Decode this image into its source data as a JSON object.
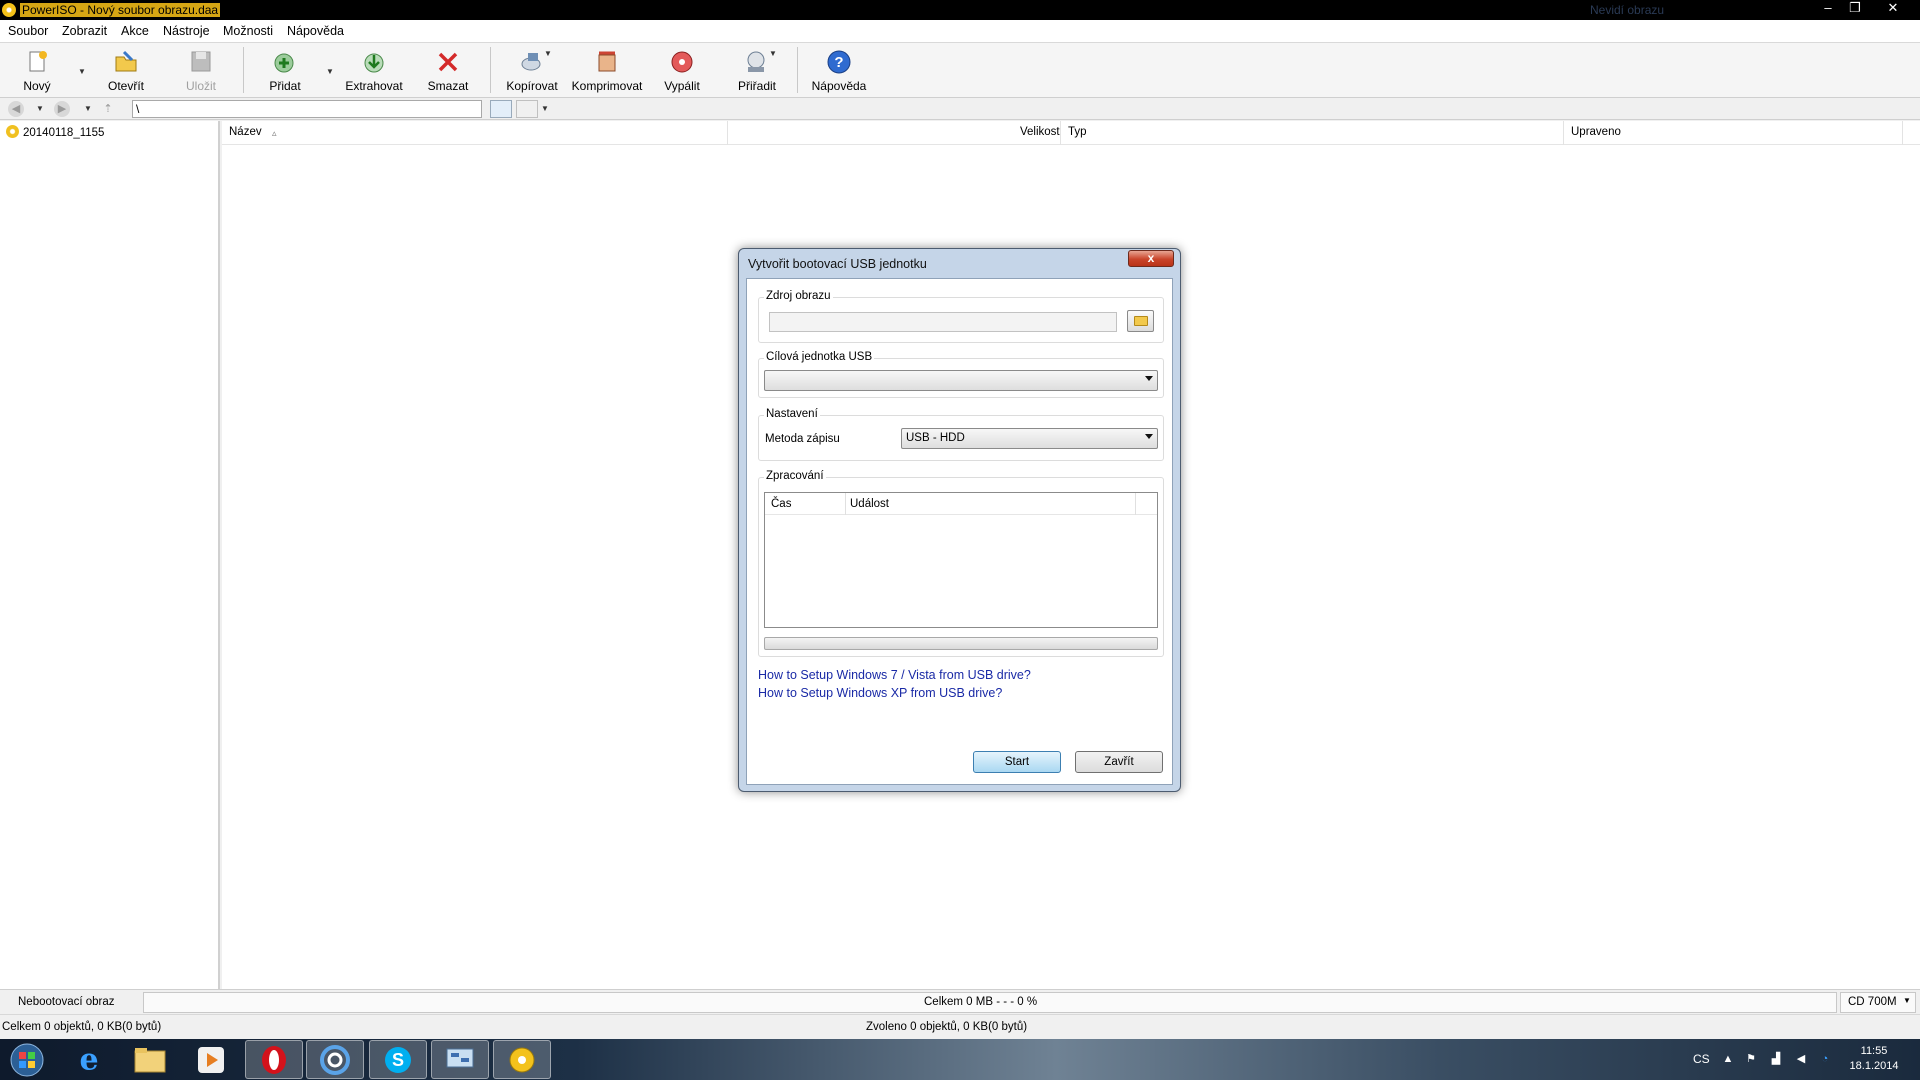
{
  "window": {
    "title": "PowerISO - Nový soubor obrazu.daa",
    "ghost_title": "Nevidí obrazu",
    "controls": [
      "–",
      "❐",
      "✕"
    ]
  },
  "menu": [
    "Soubor",
    "Zobrazit",
    "Akce",
    "Nástroje",
    "Možnosti",
    "Nápověda"
  ],
  "toolbar": {
    "new": "Nový",
    "open": "Otevřít",
    "save": "Uložit",
    "add": "Přidat",
    "extract": "Extrahovat",
    "delete": "Smazat",
    "copy": "Kopírovat",
    "compress": "Komprimovat",
    "burn": "Vypálit",
    "mount": "Přiřadit",
    "help": "Nápověda"
  },
  "address": {
    "path": "\\"
  },
  "tree": {
    "root": "20140118_1155"
  },
  "filelist": {
    "columns": {
      "name": "Název",
      "size": "Velikost",
      "type": "Typ",
      "modified": "Upraveno"
    },
    "sort_indicator": "▵"
  },
  "status": {
    "boot": "Nebootovací obraz",
    "total": "Celkem  0 MB   - - -  0 %",
    "media": "CD 700M",
    "objects_total": "Celkem 0 objektů, 0 KB(0 bytů)",
    "objects_selected": "Zvoleno 0 objektů, 0 KB(0 bytů)"
  },
  "dialog": {
    "title": "Vytvořit bootovací USB jednotku",
    "close": "x",
    "source_group": "Zdroj obrazu",
    "source_value": "",
    "target_group": "Cílová jednotka USB",
    "target_value": "",
    "settings_group": "Nastavení",
    "method_label": "Metoda zápisu",
    "method_value": "USB - HDD",
    "processing_group": "Zpracování",
    "log_columns": {
      "time": "Čas",
      "event": "Událost"
    },
    "link_win7": "How to Setup Windows 7 / Vista from USB drive?",
    "link_xp": "How to Setup Windows XP from USB drive?",
    "start": "Start",
    "close_button": "Zavřít"
  },
  "taskbar": {
    "lang": "CS",
    "time": "11:55",
    "date": "18.1.2014"
  },
  "icons": {
    "accent": "#1a2aa6",
    "title_highlight": "#d6a614"
  }
}
